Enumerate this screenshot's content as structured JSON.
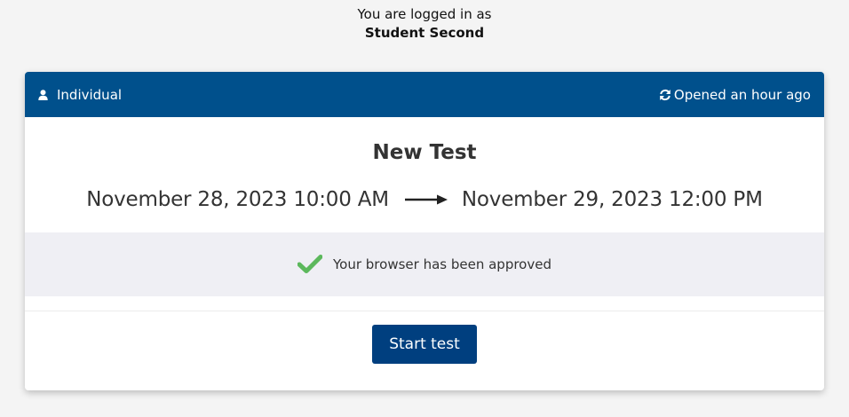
{
  "login": {
    "prefix": "You are logged in as",
    "user_name": "Student Second"
  },
  "card": {
    "header": {
      "mode_icon": "user-icon",
      "mode_label": "Individual",
      "status_icon": "refresh-icon",
      "status_label": "Opened an hour ago"
    },
    "title": "New Test",
    "start_datetime": "November 28, 2023 10:00 AM",
    "arrow_icon": "arrow-right-icon",
    "end_datetime": "November 29, 2023 12:00 PM",
    "browser_check": {
      "icon": "checkmark-icon",
      "message": "Your browser has been approved"
    },
    "start_button_label": "Start test"
  },
  "colors": {
    "header_bg": "#00508c",
    "button_bg": "#003f7f",
    "check_green": "#5cb85c",
    "status_bg": "#efeff4",
    "page_bg": "#f4f4f4"
  }
}
